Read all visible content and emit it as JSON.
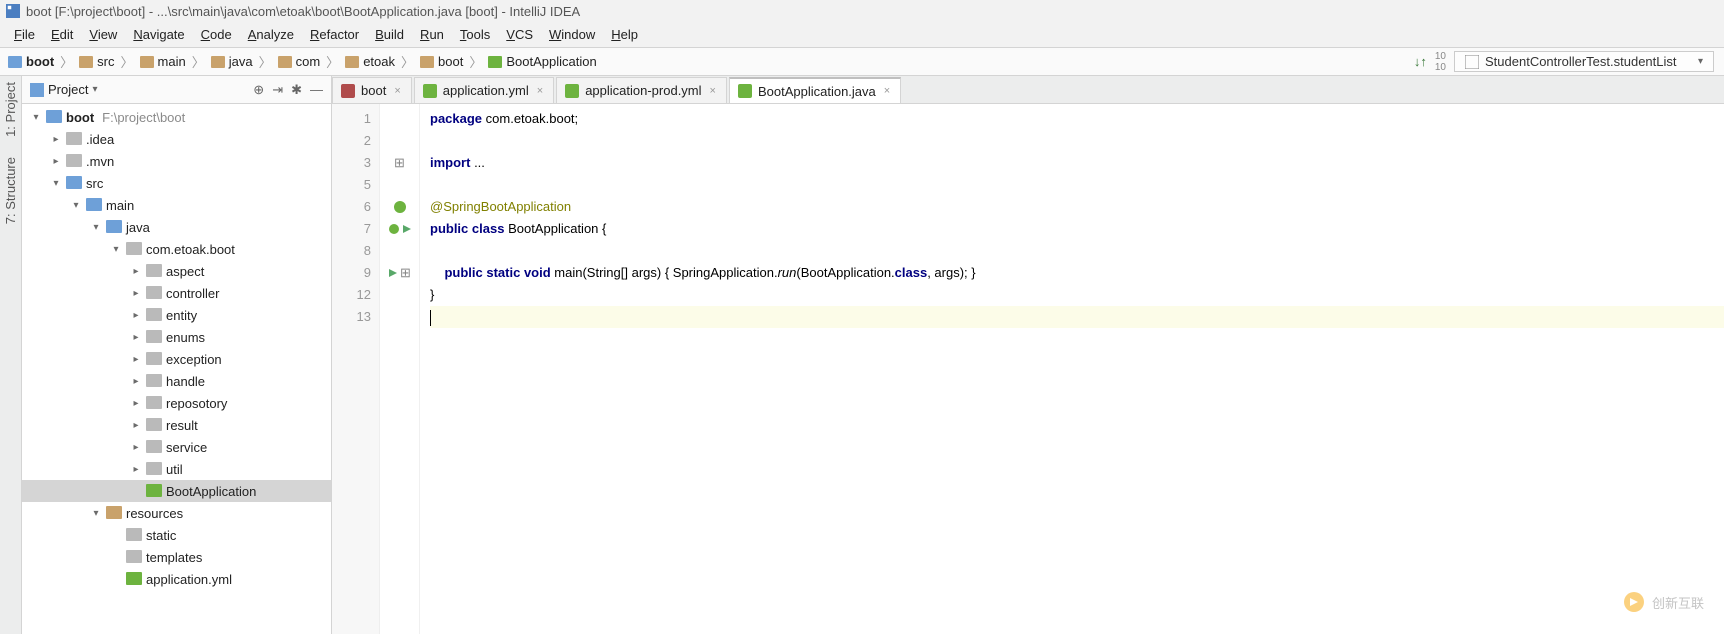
{
  "title": "boot [F:\\project\\boot] - ...\\src\\main\\java\\com\\etoak\\boot\\BootApplication.java [boot] - IntelliJ IDEA",
  "menu": [
    "File",
    "Edit",
    "View",
    "Navigate",
    "Code",
    "Analyze",
    "Refactor",
    "Build",
    "Run",
    "Tools",
    "VCS",
    "Window",
    "Help"
  ],
  "breadcrumbs": [
    "boot",
    "src",
    "main",
    "java",
    "com",
    "etoak",
    "boot",
    "BootApplication"
  ],
  "runconfig": "StudentControllerTest.studentList",
  "projectTitle": "Project",
  "leftTools": [
    "1: Project",
    "7: Structure"
  ],
  "tree": [
    {
      "depth": 0,
      "arrow": "down",
      "kind": "module",
      "label": "boot",
      "suffix": "F:\\project\\boot",
      "bold": true
    },
    {
      "depth": 1,
      "arrow": "right",
      "kind": "folder-grey",
      "label": ".idea"
    },
    {
      "depth": 1,
      "arrow": "right",
      "kind": "folder-grey",
      "label": ".mvn"
    },
    {
      "depth": 1,
      "arrow": "down",
      "kind": "folder-blue",
      "label": "src"
    },
    {
      "depth": 2,
      "arrow": "down",
      "kind": "folder-blue",
      "label": "main"
    },
    {
      "depth": 3,
      "arrow": "down",
      "kind": "folder-blue",
      "label": "java"
    },
    {
      "depth": 4,
      "arrow": "down",
      "kind": "package",
      "label": "com.etoak.boot"
    },
    {
      "depth": 5,
      "arrow": "right",
      "kind": "package",
      "label": "aspect"
    },
    {
      "depth": 5,
      "arrow": "right",
      "kind": "package",
      "label": "controller"
    },
    {
      "depth": 5,
      "arrow": "right",
      "kind": "package",
      "label": "entity"
    },
    {
      "depth": 5,
      "arrow": "right",
      "kind": "package",
      "label": "enums"
    },
    {
      "depth": 5,
      "arrow": "right",
      "kind": "package",
      "label": "exception"
    },
    {
      "depth": 5,
      "arrow": "right",
      "kind": "package",
      "label": "handle"
    },
    {
      "depth": 5,
      "arrow": "right",
      "kind": "package",
      "label": "reposotory"
    },
    {
      "depth": 5,
      "arrow": "right",
      "kind": "package",
      "label": "result"
    },
    {
      "depth": 5,
      "arrow": "right",
      "kind": "package",
      "label": "service"
    },
    {
      "depth": 5,
      "arrow": "right",
      "kind": "package",
      "label": "util"
    },
    {
      "depth": 5,
      "arrow": "",
      "kind": "class",
      "label": "BootApplication",
      "selected": true
    },
    {
      "depth": 3,
      "arrow": "down",
      "kind": "folder-res",
      "label": "resources"
    },
    {
      "depth": 4,
      "arrow": "",
      "kind": "folder-grey",
      "label": "static"
    },
    {
      "depth": 4,
      "arrow": "",
      "kind": "folder-grey",
      "label": "templates"
    },
    {
      "depth": 4,
      "arrow": "",
      "kind": "yml",
      "label": "application.yml"
    }
  ],
  "tabs": [
    {
      "icon": "maven",
      "label": "boot",
      "active": false
    },
    {
      "icon": "yml",
      "label": "application.yml",
      "active": false
    },
    {
      "icon": "yml",
      "label": "application-prod.yml",
      "active": false
    },
    {
      "icon": "class",
      "label": "BootApplication.java",
      "active": true
    }
  ],
  "lineNumbers": [
    "1",
    "2",
    "3",
    "5",
    "6",
    "7",
    "8",
    "9",
    "12",
    "13"
  ],
  "code": {
    "l1_kw": "package",
    "l1_rest": " com.etoak.boot;",
    "l3_kw": "import",
    "l3_rest": " ...",
    "l6": "@SpringBootApplication",
    "l7_a": "public",
    "l7_b": "class",
    "l7_c": " BootApplication {",
    "l9_a": "public",
    "l9_b": "static",
    "l9_c": "void",
    "l9_d": " main(String[] args) { SpringApplication.",
    "l9_e": "run",
    "l9_f": "(BootApplication.",
    "l9_g": "class",
    "l9_h": ", args); }",
    "l12": "}"
  },
  "watermark": "创新互联"
}
